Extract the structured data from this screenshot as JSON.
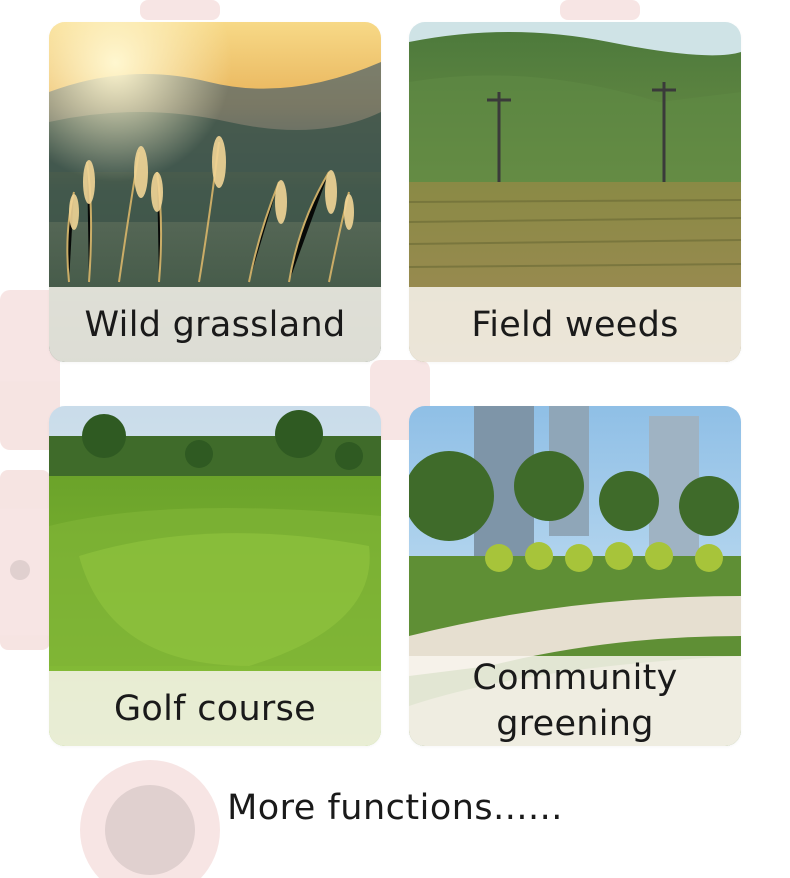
{
  "cards": [
    {
      "label": "Wild grassland",
      "scene": "wild-grassland-sunset-photo"
    },
    {
      "label": "Field weeds",
      "scene": "terraced-field-photo"
    },
    {
      "label": "Golf course",
      "scene": "golf-course-photo"
    },
    {
      "label": "Community greening",
      "line1": "Community",
      "line2": "greening",
      "scene": "community-park-photo"
    }
  ],
  "footer": {
    "text": "More functions......"
  },
  "colors": {
    "background": "#ffffff",
    "label_text": "#1a1a1a",
    "label_band": "#f8f5ee",
    "bg_machine": "#c0392b"
  }
}
